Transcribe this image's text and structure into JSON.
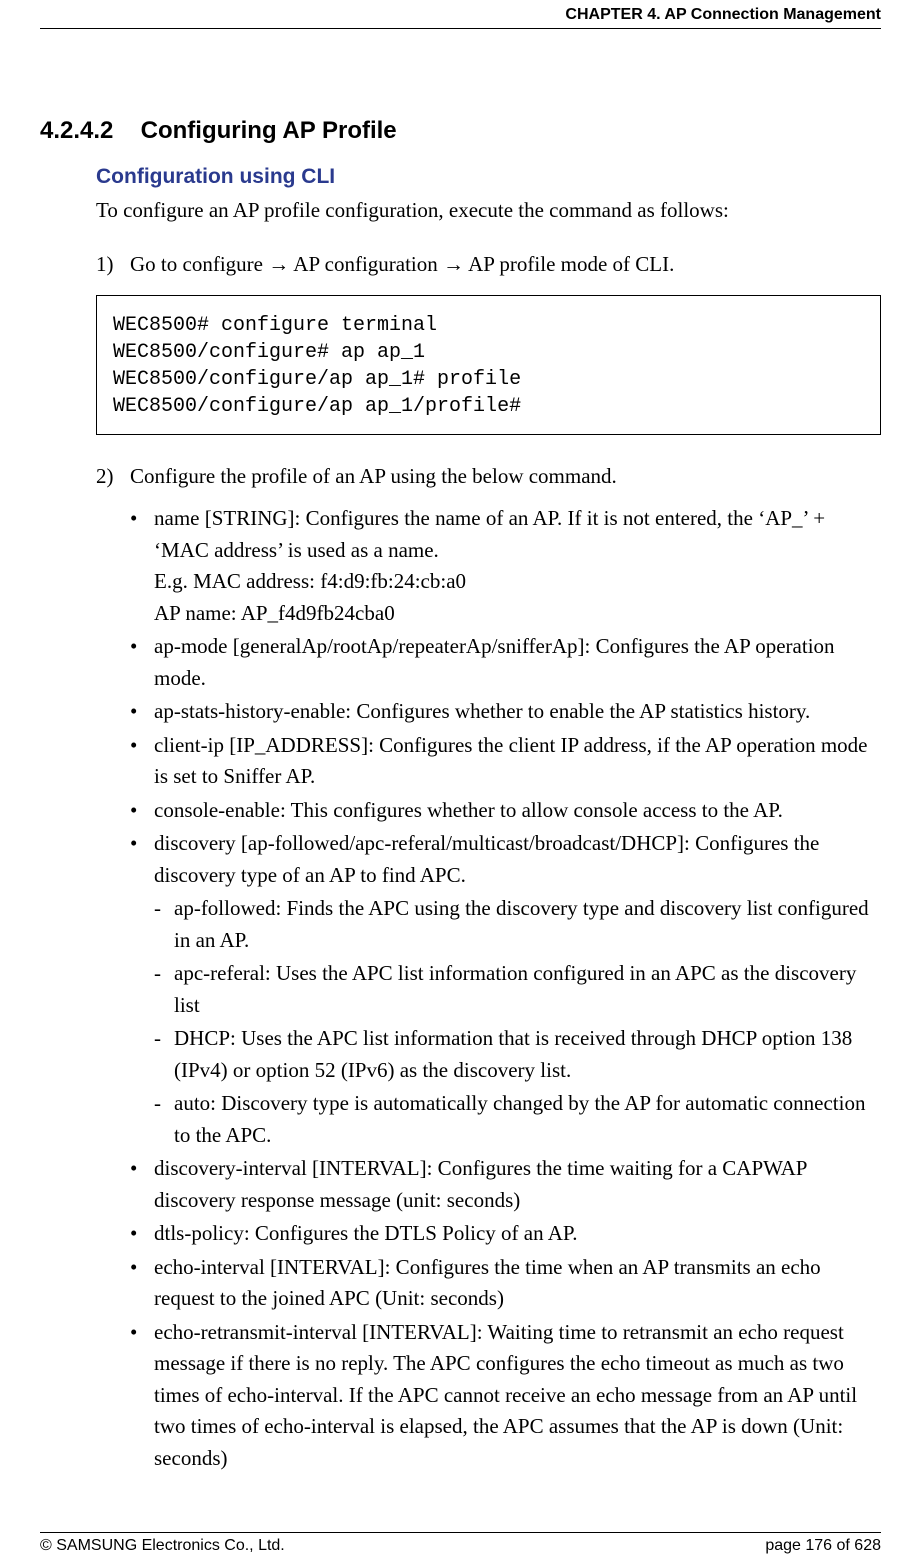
{
  "header": {
    "chapter": "CHAPTER 4. AP Connection Management"
  },
  "section": {
    "number": "4.2.4.2",
    "title": "Configuring AP Profile"
  },
  "sub_heading": "Configuration using CLI",
  "intro": "To configure an AP profile configuration, execute the command as follows:",
  "step1": {
    "num": "1)",
    "text_a": "Go to configure ",
    "text_b": " AP configuration ",
    "text_c": " AP profile mode of CLI.",
    "arrow": "→"
  },
  "code": "WEC8500# configure terminal\nWEC8500/configure# ap ap_1\nWEC8500/configure/ap ap_1# profile\nWEC8500/configure/ap ap_1/profile#",
  "step2": {
    "num": "2)",
    "text": "Configure the profile of an AP using the below command."
  },
  "bullets": [
    {
      "text": "name [STRING]: Configures the name of an AP. If it is not entered, the ‘AP_’ + ‘MAC address’ is used as a name.",
      "sub": [
        "E.g. MAC address: f4:d9:fb:24:cb:a0",
        "AP name: AP_f4d9fb24cba0"
      ]
    },
    {
      "text": "ap-mode [generalAp/rootAp/repeaterAp/snifferAp]: Configures the AP operation mode."
    },
    {
      "text": "ap-stats-history-enable: Configures whether to enable the AP statistics history."
    },
    {
      "text": "client-ip [IP_ADDRESS]: Configures the client IP address, if the AP operation mode is set to Sniffer AP."
    },
    {
      "text": "console-enable: This configures whether to allow console access to the AP."
    },
    {
      "text": "discovery [ap-followed/apc-referal/multicast/broadcast/DHCP]: Configures the discovery type of an AP to find APC.",
      "dashes": [
        "ap-followed: Finds the APC using the discovery type and discovery list configured in an AP.",
        "apc-referal: Uses the APC list information configured in an APC as the discovery list",
        "DHCP: Uses the APC list information that is received through DHCP option 138 (IPv4) or option 52 (IPv6) as the discovery list.",
        "auto: Discovery type is automatically changed by the AP for automatic connection to the APC."
      ]
    },
    {
      "text": "discovery-interval [INTERVAL]: Configures the time waiting for a CAPWAP discovery response message (unit: seconds)"
    },
    {
      "text": "dtls-policy: Configures the DTLS Policy of an AP."
    },
    {
      "text": "echo-interval [INTERVAL]: Configures the time when an AP transmits an echo request to the joined APC (Unit: seconds)"
    },
    {
      "text": "echo-retransmit-interval [INTERVAL]: Waiting time to retransmit an echo request message if there is no reply. The APC configures the echo timeout as much as two times of echo-interval. If the APC cannot receive an echo message from an AP until two times of echo-interval is elapsed, the APC assumes that the AP is down (Unit: seconds)"
    }
  ],
  "footer": {
    "copyright": "© SAMSUNG Electronics Co., Ltd.",
    "page": "page 176 of 628"
  }
}
